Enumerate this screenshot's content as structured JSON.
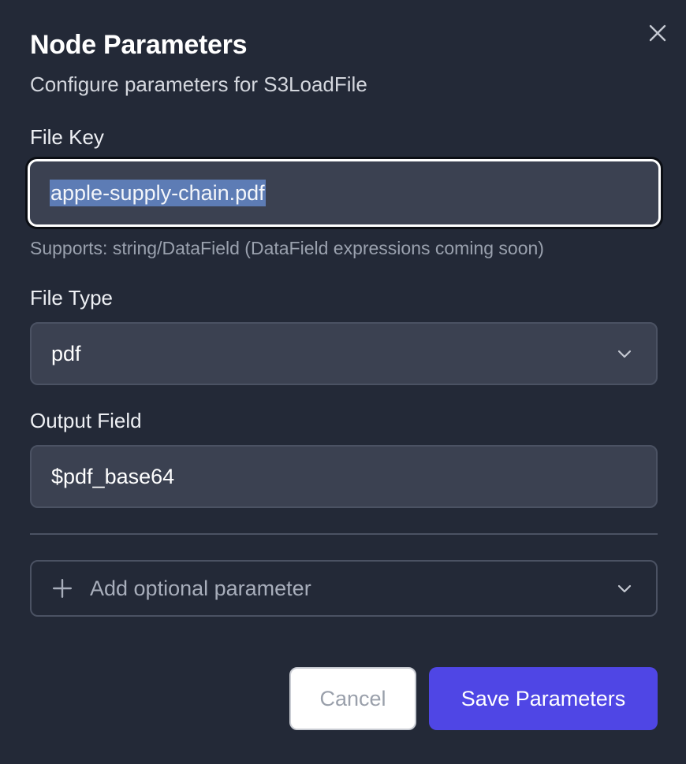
{
  "dialog": {
    "title": "Node Parameters",
    "subtitle": "Configure parameters for S3LoadFile",
    "close_icon": "close-icon"
  },
  "fields": {
    "file_key": {
      "label": "File Key",
      "value": "apple-supply-chain.pdf",
      "hint": "Supports: string/DataField (DataField expressions coming soon)"
    },
    "file_type": {
      "label": "File Type",
      "value": "pdf",
      "icon": "chevron-down-icon"
    },
    "output_field": {
      "label": "Output Field",
      "value": "$pdf_base64"
    }
  },
  "optional": {
    "label": "Add optional parameter",
    "icon": "plus-icon",
    "chevron": "chevron-down-icon"
  },
  "actions": {
    "cancel_label": "Cancel",
    "save_label": "Save Parameters"
  },
  "colors": {
    "background": "#232937",
    "field_bg": "#3b4151",
    "accent": "#4f46e5",
    "selection": "#5d7cb5"
  }
}
